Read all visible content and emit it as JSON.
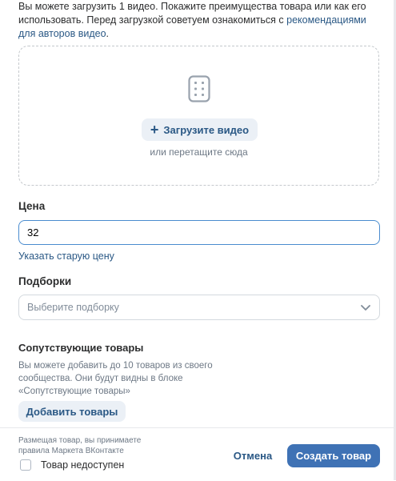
{
  "intro": {
    "text_before_link": "Вы можете загрузить 1 видео. Покажите преимущества товара или как его использовать. Перед загрузкой советуем ознакомиться с ",
    "link_text": "рекомендациями для авторов видео",
    "text_after_link": "."
  },
  "upload": {
    "button_label": "Загрузите видео",
    "hint": "или перетащите сюда",
    "icon": "video-file-icon"
  },
  "price": {
    "label": "Цена",
    "value": "32",
    "old_price_link": "Указать старую цену"
  },
  "collections": {
    "label": "Подборки",
    "placeholder": "Выберите подборку",
    "icon": "chevron-down-icon"
  },
  "related": {
    "title": "Сопутствующие товары",
    "description": "Вы можете добавить до 10 товаров из своего сообщества. Они будут видны в блоке «Сопутствующие товары»",
    "button_label": "Добавить товары"
  },
  "footer": {
    "terms_text": "Размещая товар, вы принимаете",
    "terms_link": "правила Маркета ВКонтакте",
    "unavailable_label": "Товар недоступен",
    "unavailable_checked": false,
    "cancel_label": "Отмена",
    "create_label": "Создать товар"
  },
  "colors": {
    "accent": "#2a5885",
    "primary_button": "#3f72b5",
    "secondary_button_bg": "#ebf0f6",
    "input_focus_border": "#4a8ccf"
  }
}
